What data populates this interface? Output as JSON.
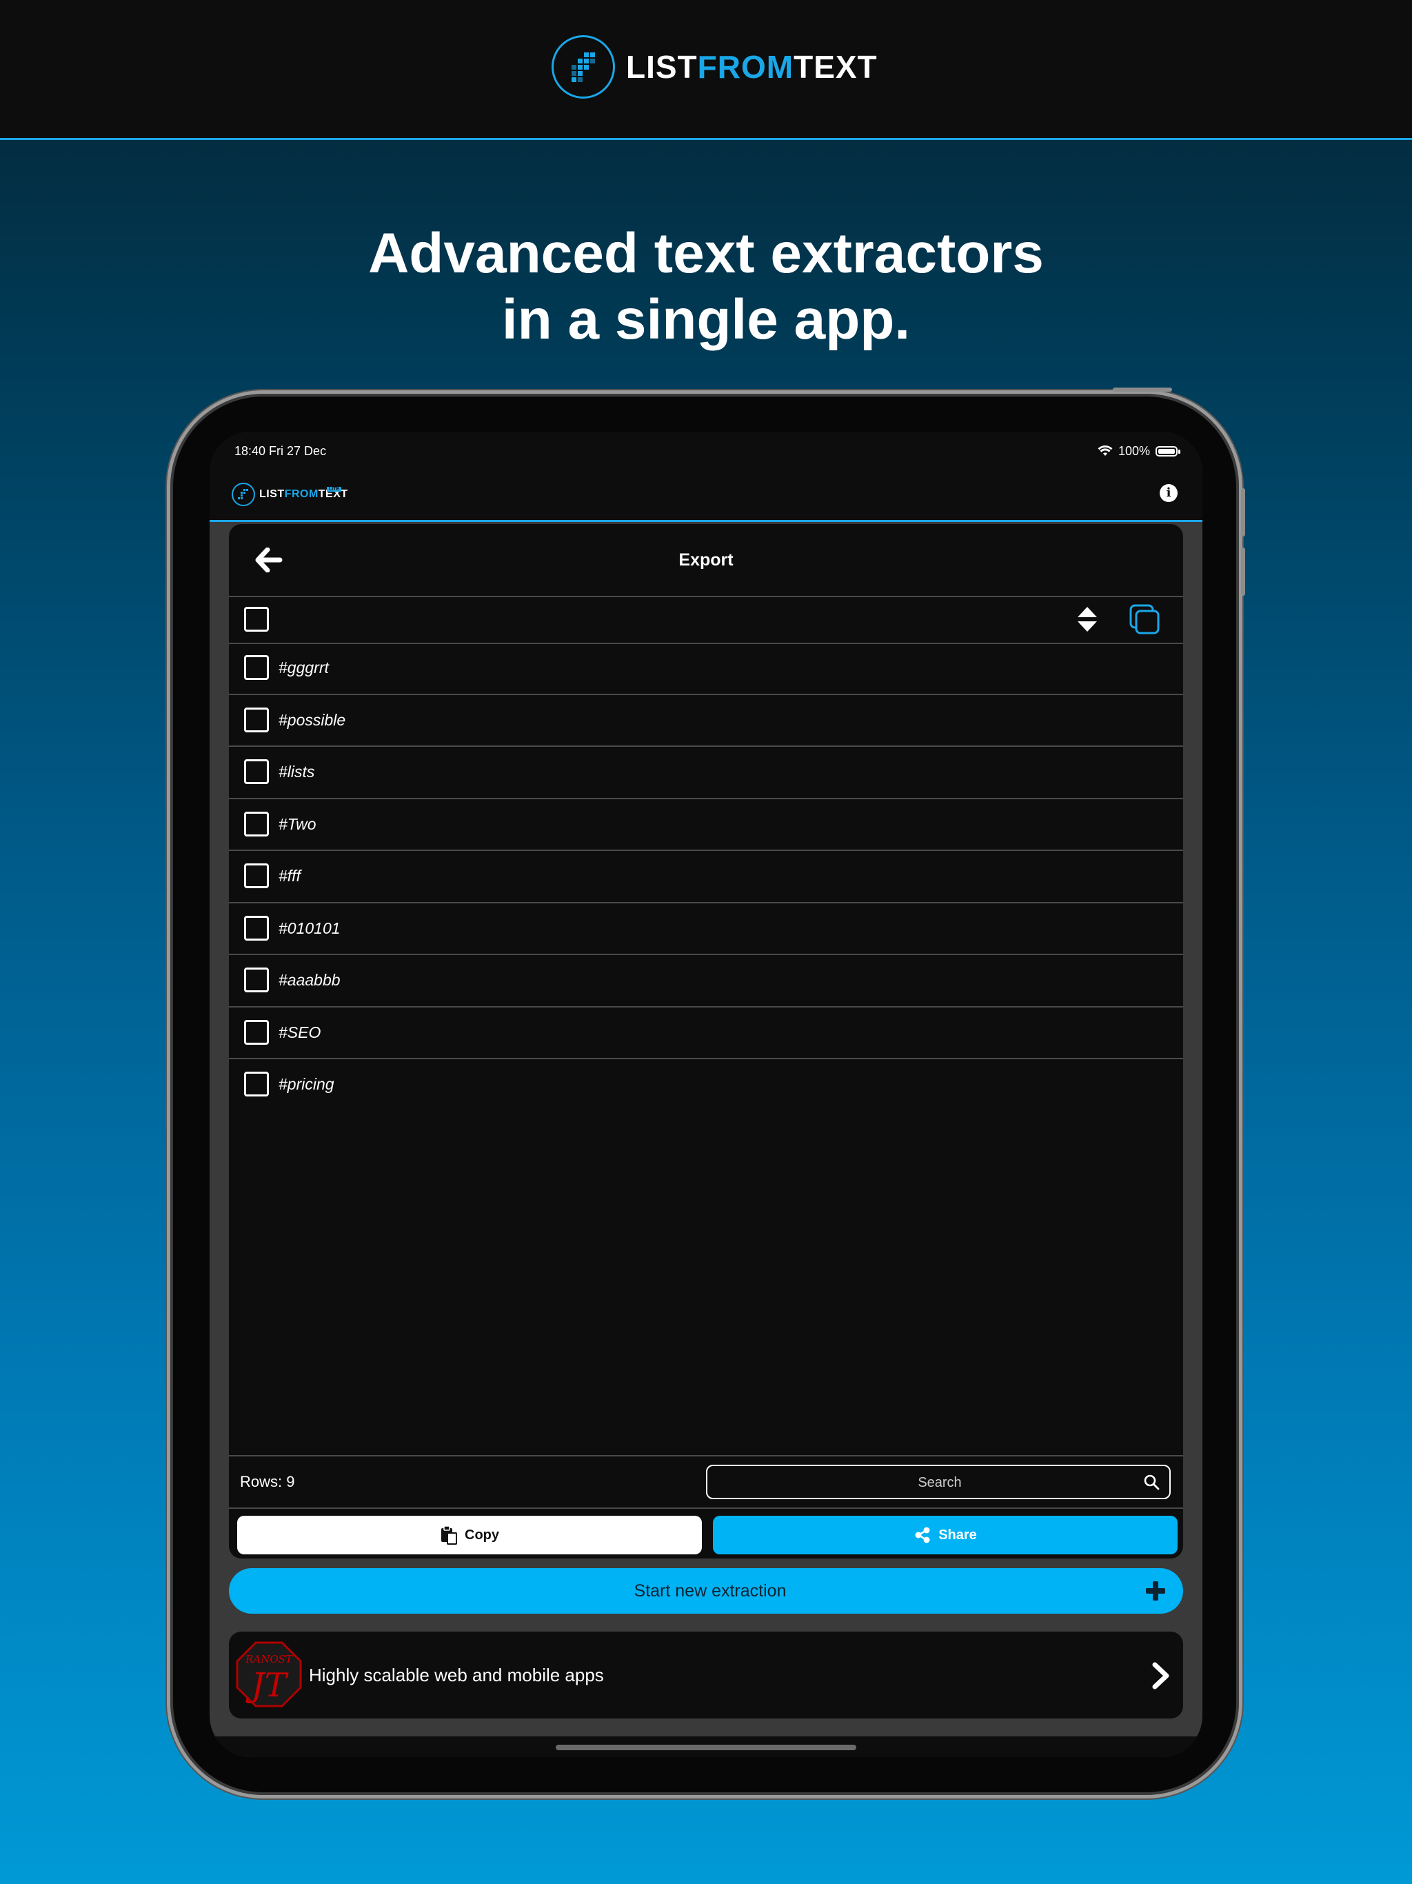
{
  "banner": {
    "brand_part1": "LIST",
    "brand_part2": "FROM",
    "brand_part3": "TEXT",
    "icon": "logo-grid-icon"
  },
  "headline": {
    "line1": "Advanced text extractors",
    "line2": "in a single app."
  },
  "status_bar": {
    "time": "18:40   Fri 27 Dec",
    "battery": "100%"
  },
  "app_bar": {
    "brand_part1": "LIST",
    "brand_part2": "FROM",
    "brand_part3": "TEXT",
    "tag": "LITE"
  },
  "export": {
    "title": "Export",
    "items": [
      "#gggrrt",
      "#possible",
      "#lists",
      "#Two",
      "#fff",
      "#010101",
      "#aaabbb",
      "#SEO",
      "#pricing"
    ],
    "rows_label": "Rows: 9",
    "search_placeholder": "Search",
    "copy_label": "Copy",
    "share_label": "Share"
  },
  "start_button": {
    "label": "Start new extraction"
  },
  "promo": {
    "text": "Highly scalable web and mobile apps",
    "logo_text": "RANOST"
  },
  "colors": {
    "accent": "#1aa7e8",
    "button_blue": "#00b3f5",
    "card_bg": "#0d0d0d",
    "screen_bg": "#3a3a3a"
  }
}
